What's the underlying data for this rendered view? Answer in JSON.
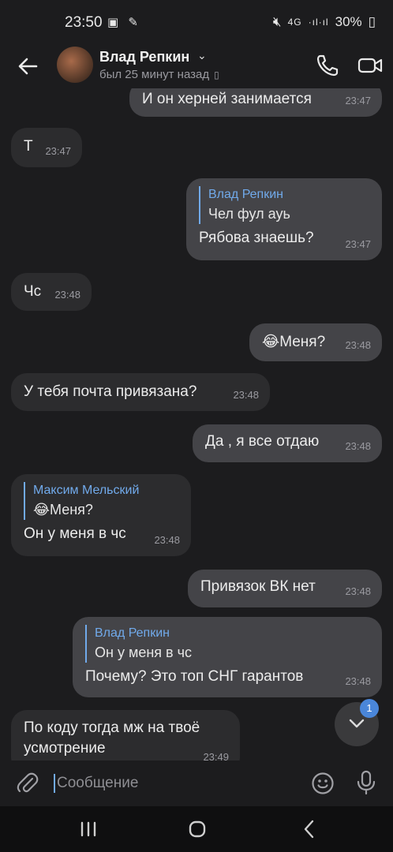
{
  "status_bar": {
    "time": "23:50",
    "left_icons": "▣ ✎",
    "network": "4G",
    "signal": "·ıl·ıl",
    "battery": "30%"
  },
  "header": {
    "name": "Влад Репкин",
    "last_seen": "был 25 минут назад"
  },
  "messages": [
    {
      "dir": "out",
      "text": "И он херней занимается",
      "time": "23:47"
    },
    {
      "dir": "in",
      "text": "Т",
      "time": "23:47"
    },
    {
      "dir": "out",
      "reply_to": {
        "name": "Влад Репкин",
        "text": "Чел фул ауь"
      },
      "text": "Рябова знаешь?",
      "time": "23:47"
    },
    {
      "dir": "in",
      "text": "Чс",
      "time": "23:48"
    },
    {
      "dir": "out",
      "text": "😂Меня?",
      "time": "23:48"
    },
    {
      "dir": "in",
      "text": "У тебя почта привязана?",
      "time": "23:48"
    },
    {
      "dir": "out",
      "text": "Да , я все отдаю",
      "time": "23:48"
    },
    {
      "dir": "in",
      "reply_to": {
        "name": "Максим Мельский",
        "text": "😂Меня?"
      },
      "text": "Он у меня в чс",
      "time": "23:48"
    },
    {
      "dir": "out",
      "text": "Привязок ВК нет",
      "time": "23:48"
    },
    {
      "dir": "out",
      "reply_to": {
        "name": "Влад Репкин",
        "text": "Он у меня в чс"
      },
      "text": "Почему? Это топ СНГ гарантов",
      "time": "23:48"
    },
    {
      "dir": "in",
      "text": "По коду тогда мж на твоё усмотрение",
      "time": "23:49"
    }
  ],
  "scroll_badge": "1",
  "composer": {
    "placeholder": "Сообщение"
  },
  "icons": {
    "back": "arrow-left-icon",
    "call": "phone-icon",
    "video": "video-camera-icon",
    "attach": "paperclip-icon",
    "emoji": "smiley-icon",
    "mic": "microphone-icon",
    "scroll": "chevron-down-icon"
  },
  "colors": {
    "background": "#1c1c1e",
    "incoming_bubble": "#2c2c2e",
    "outgoing_bubble": "#444448",
    "accent": "#71aaeb",
    "badge": "#4a86d9"
  }
}
